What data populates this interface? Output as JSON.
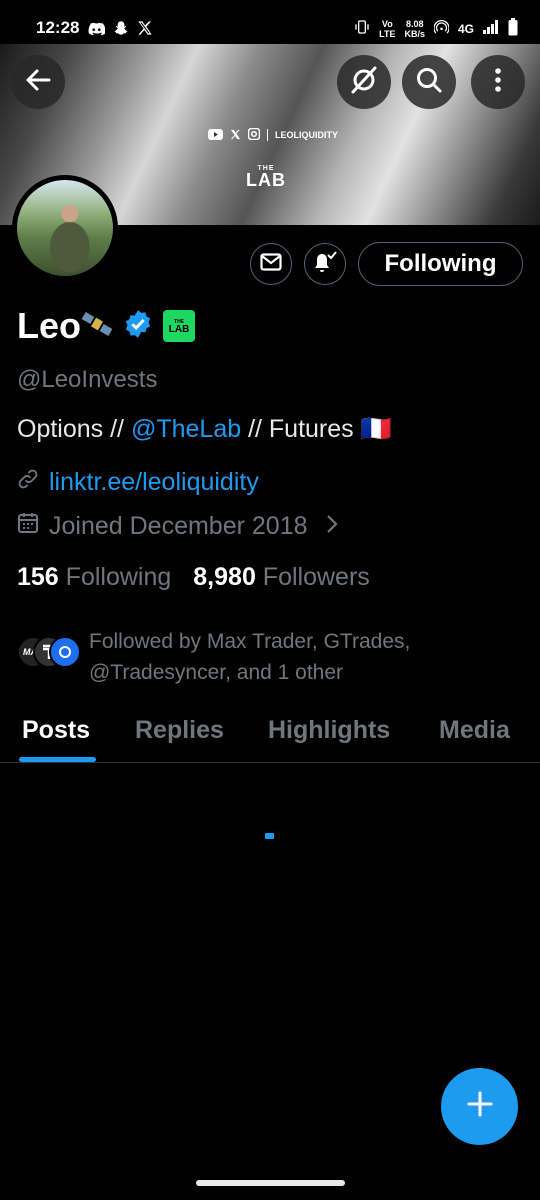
{
  "status_bar": {
    "time": "12:28",
    "net_speed_value": "8.08",
    "net_speed_unit": "KB/s",
    "volte_label": "Vo",
    "lte_label": "LTE",
    "network": "4G"
  },
  "banner": {
    "handle_text": "LEOLIQUIDITY",
    "logo_top": "THE",
    "logo_main": "LAB"
  },
  "profile": {
    "name": "Leo",
    "handle": "@LeoInvests",
    "bio_part1": "Options // ",
    "bio_mention": "@TheLab",
    "bio_part2": " // Futures 🇫🇷",
    "link": "linktr.ee/leoliquidity",
    "joined": "Joined December 2018",
    "following_count": "156",
    "following_label": "Following",
    "followers_count": "8,980",
    "followers_label": "Followers",
    "followed_by": "Followed by Max Trader, GTrades, @Tradesyncer, and 1 other",
    "badge_top": "THE",
    "badge_main": "LAB"
  },
  "actions": {
    "following_button": "Following"
  },
  "tabs": [
    {
      "label": "Posts",
      "active": true
    },
    {
      "label": "Replies",
      "active": false
    },
    {
      "label": "Highlights",
      "active": false
    },
    {
      "label": "Media",
      "active": false
    }
  ],
  "colors": {
    "accent": "#1d9bf0",
    "badge_green": "#1ed760",
    "muted": "#71767b",
    "background": "#000000"
  },
  "icons": [
    "back-arrow-icon",
    "grok-icon",
    "search-icon",
    "more-icon",
    "mail-icon",
    "bell-icon",
    "link-icon",
    "calendar-icon",
    "chevron-right-icon",
    "verified-icon",
    "satellite-emoji-icon",
    "compose-plus-icon"
  ]
}
